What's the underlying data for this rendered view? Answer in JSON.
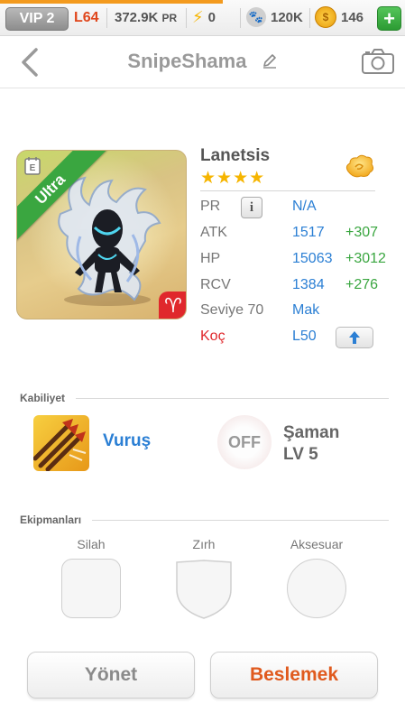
{
  "topbar": {
    "vip": "VIP 2",
    "level": "L64",
    "pr_value": "372.9K",
    "pr_unit": "PR",
    "energy": "0",
    "paw_value": "120K",
    "coin_value": "146",
    "plus": "+",
    "progress_fraction": 0.55
  },
  "header": {
    "title": "SnipeShama"
  },
  "monster": {
    "name": "Lanetsis",
    "stars": "★★★★",
    "rarity": "Ultra",
    "zodiac_symbol": "♈",
    "stats": {
      "pr": {
        "label": "PR",
        "value": "N/A",
        "info": "i"
      },
      "atk": {
        "label": "ATK",
        "value": "1517",
        "bonus": "+307"
      },
      "hp": {
        "label": "HP",
        "value": "15063",
        "bonus": "+3012"
      },
      "rcv": {
        "label": "RCV",
        "value": "1384",
        "bonus": "+276"
      },
      "level": {
        "label": "Seviye 70",
        "value": "Mak"
      },
      "sign": {
        "label": "Koç",
        "value": "L50"
      }
    }
  },
  "ability": {
    "section_title": "Kabiliyet",
    "skill_name": "Vuruş",
    "leader_state": "OFF",
    "leader_name": "Şaman",
    "leader_level": "LV 5"
  },
  "equipment": {
    "section_title": "Ekipmanları",
    "slots": [
      "Silah",
      "Zırh",
      "Aksesuar"
    ]
  },
  "actions": {
    "manage": "Yönet",
    "feed": "Beslemek"
  },
  "colors": {
    "accent_blue": "#2b7fd4",
    "bonus_green": "#3aa640",
    "zodiac_red": "#e0282c",
    "feed_orange": "#e05a1e"
  }
}
